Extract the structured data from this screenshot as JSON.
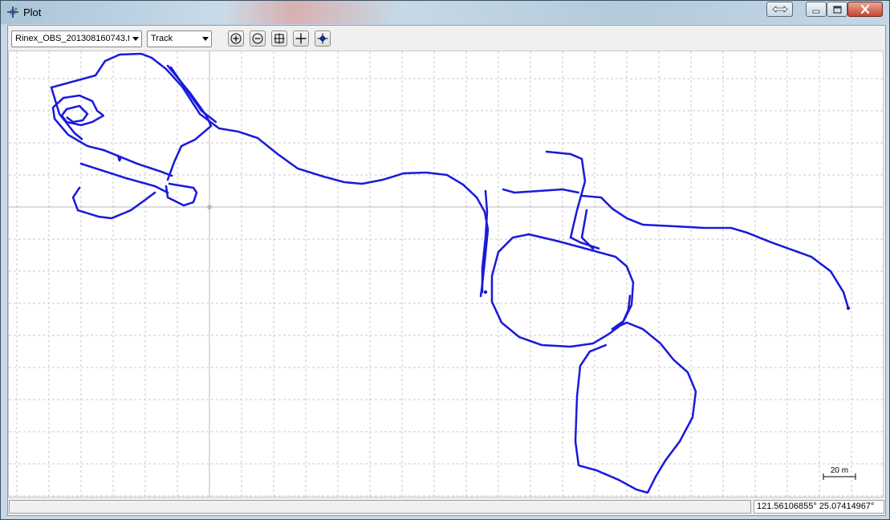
{
  "window": {
    "title": "Plot",
    "icon": "crosshair-plot-icon"
  },
  "caption_buttons": [
    "restore-resize-icon",
    "minimize-icon",
    "maximize-icon",
    "close-icon"
  ],
  "toolbar": {
    "file_select": {
      "value": "Rinex_OBS_201308160743.t"
    },
    "mode_select": {
      "value": "Track"
    },
    "buttons": [
      {
        "name": "zoom-in-button",
        "icon": "zoom-in-icon"
      },
      {
        "name": "zoom-out-button",
        "icon": "zoom-out-icon"
      },
      {
        "name": "fit-extent-button",
        "icon": "fit-extent-icon"
      },
      {
        "name": "center-origin-button",
        "icon": "crosshair-icon"
      },
      {
        "name": "center-track-button",
        "icon": "target-icon"
      }
    ]
  },
  "plot": {
    "scale_bar_label": "20 m",
    "track_color": "#1a1adc",
    "grid_color": "#c9c9c9",
    "origin_color": "#b9b9b9"
  },
  "status": {
    "message": "",
    "coordinates": "121.56106855° 25.07414967°"
  }
}
